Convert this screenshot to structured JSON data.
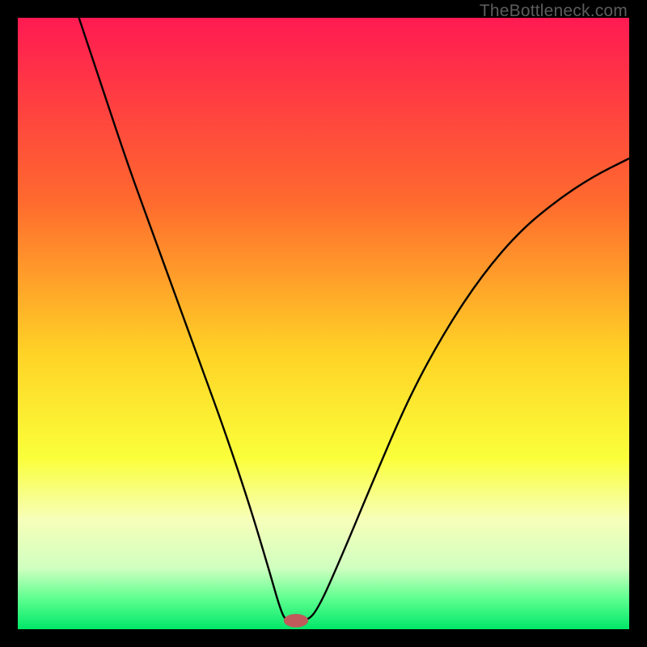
{
  "watermark": "TheBottleneck.com",
  "chart_data": {
    "type": "line",
    "title": "",
    "xlabel": "",
    "ylabel": "",
    "xlim": [
      0,
      100
    ],
    "ylim": [
      0,
      100
    ],
    "gradient_stops": [
      {
        "offset": 0,
        "color": "#ff1a52"
      },
      {
        "offset": 30,
        "color": "#ff6a2e"
      },
      {
        "offset": 55,
        "color": "#ffd326"
      },
      {
        "offset": 72,
        "color": "#faff3a"
      },
      {
        "offset": 82,
        "color": "#f7ffb9"
      },
      {
        "offset": 90,
        "color": "#d0ffc0"
      },
      {
        "offset": 95,
        "color": "#5eff90"
      },
      {
        "offset": 100,
        "color": "#00e768"
      }
    ],
    "series": [
      {
        "name": "bottleneck-curve",
        "stroke": "#000000",
        "points": [
          {
            "x": 10,
            "y": 100
          },
          {
            "x": 14,
            "y": 88
          },
          {
            "x": 18,
            "y": 76
          },
          {
            "x": 22,
            "y": 65
          },
          {
            "x": 26,
            "y": 54
          },
          {
            "x": 30,
            "y": 43
          },
          {
            "x": 34,
            "y": 32
          },
          {
            "x": 38,
            "y": 20
          },
          {
            "x": 41,
            "y": 10
          },
          {
            "x": 43,
            "y": 3
          },
          {
            "x": 44,
            "y": 1.2
          },
          {
            "x": 47,
            "y": 1.2
          },
          {
            "x": 49,
            "y": 3
          },
          {
            "x": 53,
            "y": 12
          },
          {
            "x": 58,
            "y": 24
          },
          {
            "x": 64,
            "y": 38
          },
          {
            "x": 70,
            "y": 49
          },
          {
            "x": 76,
            "y": 58
          },
          {
            "x": 82,
            "y": 65
          },
          {
            "x": 88,
            "y": 70
          },
          {
            "x": 94,
            "y": 74
          },
          {
            "x": 100,
            "y": 77
          }
        ]
      }
    ],
    "marker": {
      "cx": 45.5,
      "cy": 1.4,
      "rx": 2.0,
      "ry": 1.1,
      "fill": "#c15a5a"
    }
  }
}
